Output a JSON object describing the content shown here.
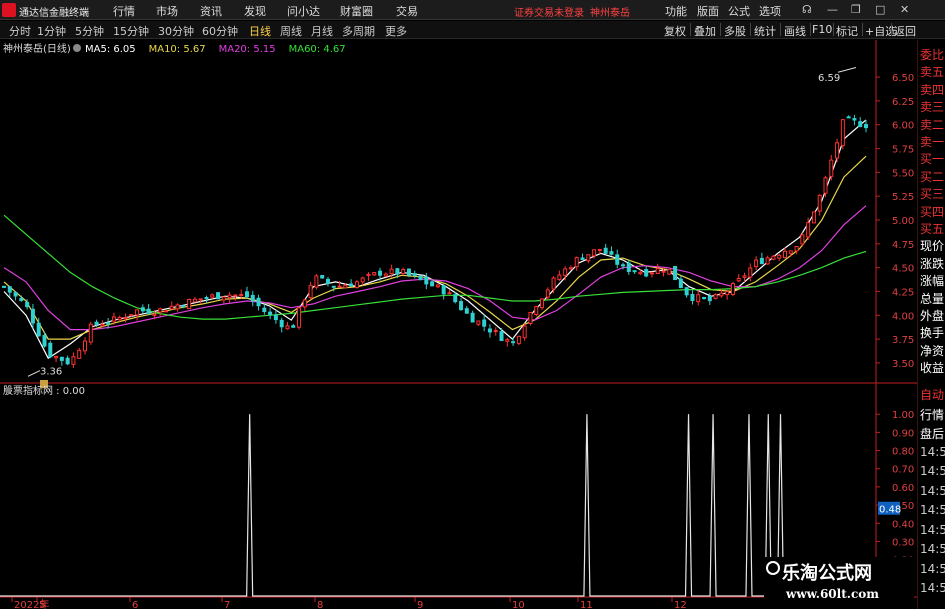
{
  "app": {
    "title": "通达信金融终端"
  },
  "menu": {
    "items": [
      "行情",
      "市场",
      "资讯",
      "发现",
      "问小达",
      "财富圈",
      "交易"
    ],
    "notice": "证券交易未登录",
    "stock_name": "神州泰岳",
    "right": [
      "功能",
      "版面",
      "公式",
      "选项"
    ]
  },
  "toolbar": {
    "periods": [
      "分时",
      "1分钟",
      "5分钟",
      "15分钟",
      "30分钟",
      "60分钟",
      "日线",
      "周线",
      "月线",
      "多周期",
      "更多"
    ],
    "active_period": "日线",
    "right": [
      "复权",
      "叠加",
      "多股",
      "统计",
      "画线",
      "F10",
      "标记",
      "+自选",
      "返回"
    ]
  },
  "chart_header": {
    "stock_label": "神州泰岳(日线)",
    "ma": [
      {
        "label": "MA5: 6.05",
        "color": "#ffffff"
      },
      {
        "label": "MA10: 5.67",
        "color": "#e8d84a"
      },
      {
        "label": "MA20: 5.15",
        "color": "#e040e0"
      },
      {
        "label": "MA60: 4.67",
        "color": "#38e038"
      }
    ]
  },
  "indicator_header": {
    "label": "股票指标网 : 0.00"
  },
  "colors": {
    "up": "#ff3030",
    "down": "#30d0d0",
    "grid": "#5a0f0f",
    "axis": "#c02020"
  },
  "chart_data": [
    {
      "type": "candlestick",
      "title": "神州泰岳(日线)",
      "ylim": [
        3.3,
        6.7
      ],
      "y_ticks": [
        "6.50",
        "6.25",
        "6.00",
        "5.75",
        "5.50",
        "5.25",
        "5.00",
        "4.75",
        "4.50",
        "4.25",
        "4.00",
        "3.75",
        "3.50"
      ],
      "x_ticks": [
        "2022年",
        "5",
        "6",
        "7",
        "8",
        "9",
        "10",
        "11",
        "12"
      ],
      "annotations": {
        "high_label": "6.59",
        "low_label": "3.36"
      },
      "series": [
        {
          "name": "MA5",
          "value_label": "6.05",
          "color": "#ffffff",
          "values": [
            4.25,
            4.0,
            3.55,
            3.7,
            3.88,
            3.95,
            4.0,
            4.05,
            4.1,
            4.15,
            4.2,
            4.18,
            4.1,
            3.95,
            4.3,
            4.35,
            4.3,
            4.38,
            4.45,
            4.42,
            4.3,
            4.15,
            3.95,
            3.75,
            4.05,
            4.3,
            4.55,
            4.65,
            4.58,
            4.45,
            4.48,
            4.3,
            4.2,
            4.25,
            4.45,
            4.65,
            4.82,
            5.2,
            5.85,
            6.05
          ]
        },
        {
          "name": "MA10",
          "value_label": "5.67",
          "color": "#e8d84a",
          "values": [
            4.35,
            4.15,
            3.75,
            3.75,
            3.85,
            3.92,
            3.98,
            4.03,
            4.08,
            4.12,
            4.17,
            4.18,
            4.12,
            4.03,
            4.18,
            4.28,
            4.3,
            4.35,
            4.42,
            4.4,
            4.33,
            4.2,
            4.03,
            3.85,
            3.95,
            4.15,
            4.4,
            4.58,
            4.6,
            4.52,
            4.48,
            4.38,
            4.27,
            4.25,
            4.35,
            4.52,
            4.7,
            5.0,
            5.45,
            5.67
          ]
        },
        {
          "name": "MA20",
          "value_label": "5.15",
          "color": "#e040e0",
          "values": [
            4.5,
            4.35,
            4.05,
            3.85,
            3.85,
            3.88,
            3.93,
            3.98,
            4.03,
            4.08,
            4.12,
            4.15,
            4.13,
            4.08,
            4.12,
            4.2,
            4.25,
            4.3,
            4.36,
            4.38,
            4.36,
            4.28,
            4.15,
            3.98,
            3.95,
            4.05,
            4.22,
            4.4,
            4.5,
            4.52,
            4.5,
            4.45,
            4.36,
            4.3,
            4.3,
            4.38,
            4.5,
            4.68,
            4.95,
            5.15
          ]
        },
        {
          "name": "MA60",
          "value_label": "4.67",
          "color": "#38e038",
          "values": [
            5.05,
            4.85,
            4.65,
            4.45,
            4.3,
            4.18,
            4.08,
            4.02,
            3.98,
            3.96,
            3.96,
            3.98,
            4.0,
            4.02,
            4.05,
            4.08,
            4.11,
            4.14,
            4.17,
            4.19,
            4.21,
            4.21,
            4.18,
            4.15,
            4.15,
            4.17,
            4.2,
            4.22,
            4.24,
            4.25,
            4.26,
            4.27,
            4.27,
            4.28,
            4.3,
            4.35,
            4.42,
            4.5,
            4.6,
            4.67
          ]
        }
      ],
      "candles_close": [
        4.3,
        4.1,
        3.6,
        3.5,
        3.9,
        3.95,
        4.05,
        4.05,
        4.12,
        4.18,
        4.22,
        4.2,
        4.0,
        3.85,
        4.4,
        4.3,
        4.35,
        4.45,
        4.45,
        4.35,
        4.25,
        4.0,
        3.85,
        3.7,
        4.1,
        4.4,
        4.6,
        4.7,
        4.5,
        4.45,
        4.5,
        4.2,
        4.15,
        4.3,
        4.55,
        4.65,
        4.75,
        5.3,
        6.05,
        6.0
      ]
    },
    {
      "type": "line",
      "title": "股票指标网",
      "ylim": [
        0,
        1.1
      ],
      "y_ticks": [
        "1.00",
        "0.90",
        "0.80",
        "0.70",
        "0.60",
        "0.50",
        "0.40",
        "0.30",
        "0.20",
        "0.10"
      ],
      "current_label": "0.48",
      "signals": [
        0.285,
        0.67,
        0.786,
        0.814,
        0.855,
        0.877,
        0.891
      ]
    }
  ],
  "side_panel": {
    "items": [
      {
        "label": "委比",
        "tone": "up"
      },
      {
        "label": "卖五",
        "tone": "up"
      },
      {
        "label": "卖四",
        "tone": "up"
      },
      {
        "label": "卖三",
        "tone": "up"
      },
      {
        "label": "卖二",
        "tone": "up"
      },
      {
        "label": "卖一",
        "tone": "up"
      },
      {
        "label": "买一",
        "tone": "up"
      },
      {
        "label": "买二",
        "tone": "up"
      },
      {
        "label": "买三",
        "tone": "up"
      },
      {
        "label": "买四",
        "tone": "up"
      },
      {
        "label": "买五",
        "tone": "up"
      },
      {
        "label": "现价",
        "tone": "white"
      },
      {
        "label": "涨跌",
        "tone": "white"
      },
      {
        "label": "涨幅",
        "tone": "white"
      },
      {
        "label": "总量",
        "tone": "white"
      },
      {
        "label": "外盘",
        "tone": "white"
      },
      {
        "label": "换手",
        "tone": "white"
      },
      {
        "label": "净资",
        "tone": "white"
      },
      {
        "label": "收益",
        "tone": "white"
      }
    ],
    "lower": [
      {
        "label": "自动",
        "tone": "up"
      },
      {
        "label": "行情",
        "tone": "white"
      },
      {
        "label": "盘后",
        "tone": "white"
      },
      {
        "label": "14:50",
        "tone": "muted"
      },
      {
        "label": "14:50",
        "tone": "muted"
      },
      {
        "label": "14:50",
        "tone": "muted"
      },
      {
        "label": "14:50",
        "tone": "muted"
      },
      {
        "label": "14:50",
        "tone": "muted"
      },
      {
        "label": "14:50",
        "tone": "muted"
      },
      {
        "label": "14:50",
        "tone": "muted"
      },
      {
        "label": "14:50",
        "tone": "muted"
      }
    ]
  },
  "watermark": {
    "title": "乐淘公式网",
    "url": "www.60lt.com"
  }
}
